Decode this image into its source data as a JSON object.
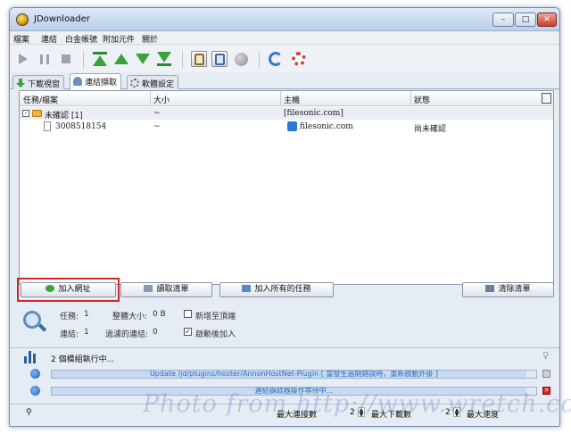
{
  "window": {
    "title": "JDownloader",
    "min": "–",
    "max": "□",
    "close": "✕"
  },
  "menu": [
    "檔案",
    "連結",
    "白金帳號",
    "附加元件",
    "關於"
  ],
  "tabs": [
    {
      "label": "下載視窗"
    },
    {
      "label": "連結擷取"
    },
    {
      "label": "軟體設定"
    }
  ],
  "table": {
    "headers": [
      "任務/檔案",
      "大小",
      "主機",
      "狀態"
    ],
    "group": {
      "expander": "-",
      "name": "未確認 [1]",
      "size": "~",
      "host": "[filesonic.com]",
      "status": ""
    },
    "rows": [
      {
        "name": "3008518154",
        "size": "~",
        "host": "filesonic.com",
        "status": "尚未確認"
      }
    ]
  },
  "buttons": {
    "add_url": "加入網址",
    "load_list": "讀取清單",
    "add_all": "加入所有的任務",
    "clear_list": "清除清單"
  },
  "info": {
    "tasks_label": "任務:",
    "tasks_value": "1",
    "total_size_label": "整體大小:",
    "total_size_value": "0 B",
    "links_label": "連結:",
    "links_value": "1",
    "filtered_label": "過濾的連結:",
    "filtered_value": "0",
    "add_top_label": "新增至頂端",
    "add_top_checked": false,
    "auto_add_label": "啟動後加入",
    "auto_add_checked": true
  },
  "status": {
    "modules_text": "2 個模組執行中...",
    "progress1_text": "Update /jd/plugins/hoster/AnnonHostNet-Plugin [ 當發生過期錯誤時，重新啟動外掛 ]",
    "progress1_value": 0.98,
    "progress2_text": "連結擷取器操作等待中...",
    "progress2_value": 0.98
  },
  "bottom": {
    "max_connections_label": "最大連接數",
    "max_connections_value": "2",
    "max_downloads_label": "最大下載數",
    "max_downloads_value": "2",
    "max_speed_label": "最大速度"
  },
  "watermark": "Photo from http://www.wretch.cc",
  "colors": {
    "highlight": "#d42525",
    "accent": "#2b79d6",
    "green_arrow": "#3aa43a"
  }
}
